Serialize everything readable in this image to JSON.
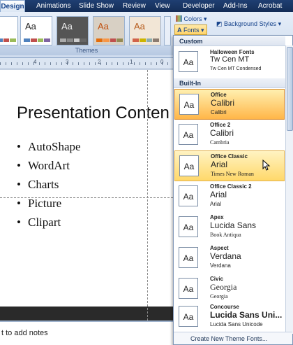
{
  "ribbon": {
    "tabs": [
      "Design",
      "Animations",
      "Slide Show",
      "Review",
      "View",
      "Developer",
      "Add-Ins",
      "Acrobat"
    ],
    "active_tab": "Design",
    "group_label": "Themes",
    "colors_label": "Colors",
    "fonts_label": "Fonts",
    "background_styles_label": "Background Styles",
    "theme_thumb_label": "Aa"
  },
  "ruler": {
    "numbers": [
      "4",
      "3",
      "2",
      "1",
      "0"
    ]
  },
  "slide": {
    "title": "Presentation Conten",
    "bullet_marker": "•",
    "bullets": [
      "AutoShape",
      "WordArt",
      "Charts",
      "Picture",
      "Clipart"
    ]
  },
  "notes": {
    "text": "t to add notes"
  },
  "dropdown": {
    "section_custom": "Custom",
    "section_builtin": "Built-In",
    "icon_label": "Aa",
    "footer": "Create New Theme Fonts...",
    "items": [
      {
        "name": "Halloween Fonts",
        "heading": "Tw Cen MT",
        "body": "Tw Cen MT Condensed"
      },
      {
        "name": "Office",
        "heading": "Calibri",
        "body": "Calibri"
      },
      {
        "name": "Office 2",
        "heading": "Calibri",
        "body": "Cambria"
      },
      {
        "name": "Office Classic",
        "heading": "Arial",
        "body": "Times New Roman"
      },
      {
        "name": "Office Classic 2",
        "heading": "Arial",
        "body": "Arial"
      },
      {
        "name": "Apex",
        "heading": "Lucida Sans",
        "body": "Book Antiqua"
      },
      {
        "name": "Aspect",
        "heading": "Verdana",
        "body": "Verdana"
      },
      {
        "name": "Civic",
        "heading": "Georgia",
        "body": "Georgia"
      },
      {
        "name": "Concourse",
        "heading": "Lucida Sans Uni...",
        "body": "Lucida Sans Unicode"
      }
    ]
  },
  "colors": {
    "selected_item": "#ffb648",
    "hover_item": "#ffd86a",
    "ribbon_tab_bar": "#1f3f72"
  }
}
